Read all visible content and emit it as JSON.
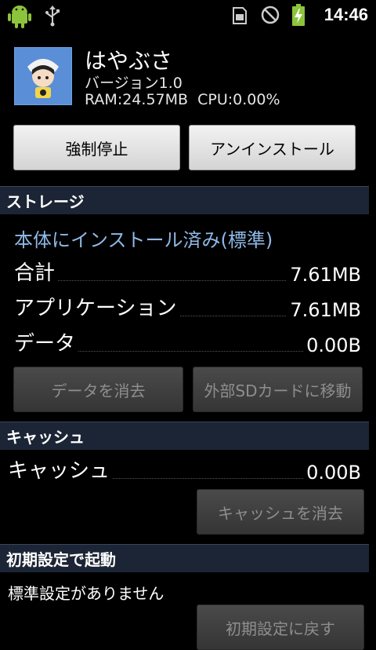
{
  "status_bar": {
    "time": "14:46",
    "icons": [
      "android-icon",
      "usb-icon",
      "sim-card-icon",
      "no-signal-icon",
      "battery-charging-icon"
    ]
  },
  "app": {
    "name": "はやぶさ",
    "version": "バージョン1.0",
    "stats": "RAM:24.57MB  CPU:0.00%"
  },
  "actions": {
    "force_stop": "強制停止",
    "uninstall": "アンインストール"
  },
  "storage": {
    "header": "ストレージ",
    "install_location": "本体にインストール済み(標準)",
    "rows": [
      {
        "label": "合計",
        "value": "7.61MB"
      },
      {
        "label": "アプリケーション",
        "value": "7.61MB"
      },
      {
        "label": "データ",
        "value": "0.00B"
      }
    ],
    "clear_data": "データを消去",
    "move_to_sd": "外部SDカードに移動"
  },
  "cache": {
    "header": "キャッシュ",
    "label": "キャッシュ",
    "value": "0.00B",
    "clear_cache": "キャッシュを消去"
  },
  "defaults": {
    "header": "初期設定で起動",
    "text": "標準設定がありません",
    "clear_defaults": "初期設定に戻す"
  },
  "colors": {
    "section_header_bg": "#1c2535",
    "install_location_text": "#8fb9e6"
  }
}
